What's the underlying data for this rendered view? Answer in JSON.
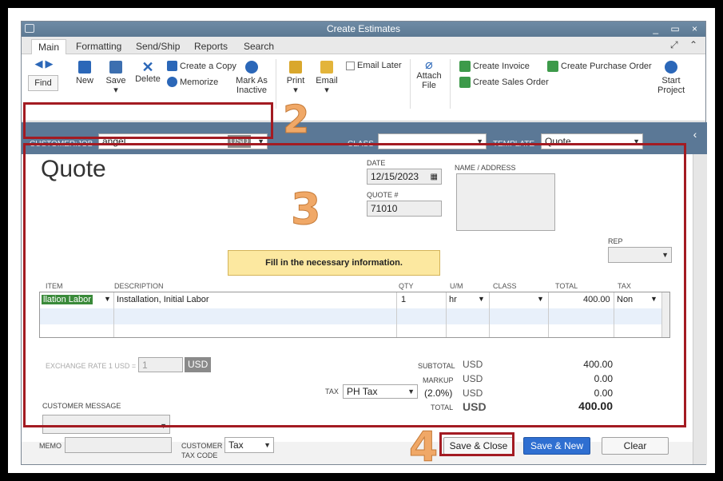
{
  "window": {
    "title": "Create Estimates",
    "controls": "_ ▭ ×"
  },
  "tabs": [
    "Main",
    "Formatting",
    "Send/Ship",
    "Reports",
    "Search"
  ],
  "toolbar": {
    "find": "Find",
    "new": "New",
    "save": "Save",
    "delete": "Delete",
    "create_copy": "Create a Copy",
    "memorize": "Memorize",
    "mark_as_inactive_1": "Mark As",
    "mark_as_inactive_2": "Inactive",
    "print": "Print",
    "email": "Email",
    "email_later": "Email Later",
    "attach_file_1": "Attach",
    "attach_file_2": "File",
    "create_invoice": "Create Invoice",
    "create_sales_order": "Create Sales Order",
    "create_purchase_order": "Create Purchase Order",
    "start_project_1": "Start",
    "start_project_2": "Project"
  },
  "header": {
    "customer_job_label": "CUSTOMER:JOB",
    "customer_job_value": "angel",
    "currency": "USD",
    "class_label": "CLASS",
    "class_value": "",
    "template_label": "TEMPLATE",
    "template_value": "Quote"
  },
  "form": {
    "title": "Quote",
    "date_label": "DATE",
    "date_value": "12/15/2023",
    "quote_no_label": "QUOTE #",
    "quote_no_value": "71010",
    "name_address_label": "NAME / ADDRESS",
    "rep_label": "REP",
    "note": "Fill in the necessary information."
  },
  "grid": {
    "columns": [
      "ITEM",
      "DESCRIPTION",
      "QTY",
      "U/M",
      "CLASS",
      "TOTAL",
      "TAX"
    ],
    "rows": [
      {
        "item": "llation Labor",
        "description": "Installation, Initial Labor",
        "qty": "1",
        "um": "hr",
        "class": "",
        "total": "400.00",
        "tax": "Non"
      }
    ]
  },
  "footer": {
    "exchange_rate_label": "EXCHANGE RATE 1 USD =",
    "exchange_rate_value": "1",
    "exchange_currency": "USD",
    "customer_message_label": "CUSTOMER MESSAGE",
    "tax_label": "TAX",
    "tax_value": "PH Tax",
    "subtotal_label": "SUBTOTAL",
    "markup_label": "MARKUP",
    "tax_rate": "(2.0%)",
    "total_label": "TOTAL",
    "currency": "USD",
    "subtotal": "400.00",
    "markup": "0.00",
    "tax_amount": "0.00",
    "total": "400.00",
    "memo_label": "MEMO",
    "customer_tax_code_label_1": "CUSTOMER",
    "customer_tax_code_label_2": "TAX CODE",
    "customer_tax_code_value": "Tax"
  },
  "buttons": {
    "save_close": "Save & Close",
    "save_new": "Save & New",
    "clear": "Clear"
  },
  "annotations": {
    "step2": "2",
    "step3": "3",
    "step4": "4"
  },
  "colors": {
    "title_bar": "#5c7993",
    "header_bar": "#5b7896",
    "highlight_red": "#a31b22",
    "annotation_orange": "#f0a867",
    "note_yellow": "#fce8a0",
    "save_new_blue": "#2f6fd1",
    "item_highlight": "#3a8a3a"
  },
  "icons": [
    "back-arrow-icon",
    "forward-arrow-icon",
    "new-doc-icon",
    "save-disk-icon",
    "delete-x-icon",
    "copy-icon",
    "memorize-icon",
    "mark-inactive-check-icon",
    "printer-icon",
    "envelope-icon",
    "paperclip-icon",
    "invoice-icon",
    "sales-order-icon",
    "purchase-order-icon",
    "start-project-icon",
    "calendar-icon",
    "chevron-down-icon",
    "collapse-chevron-icon"
  ]
}
